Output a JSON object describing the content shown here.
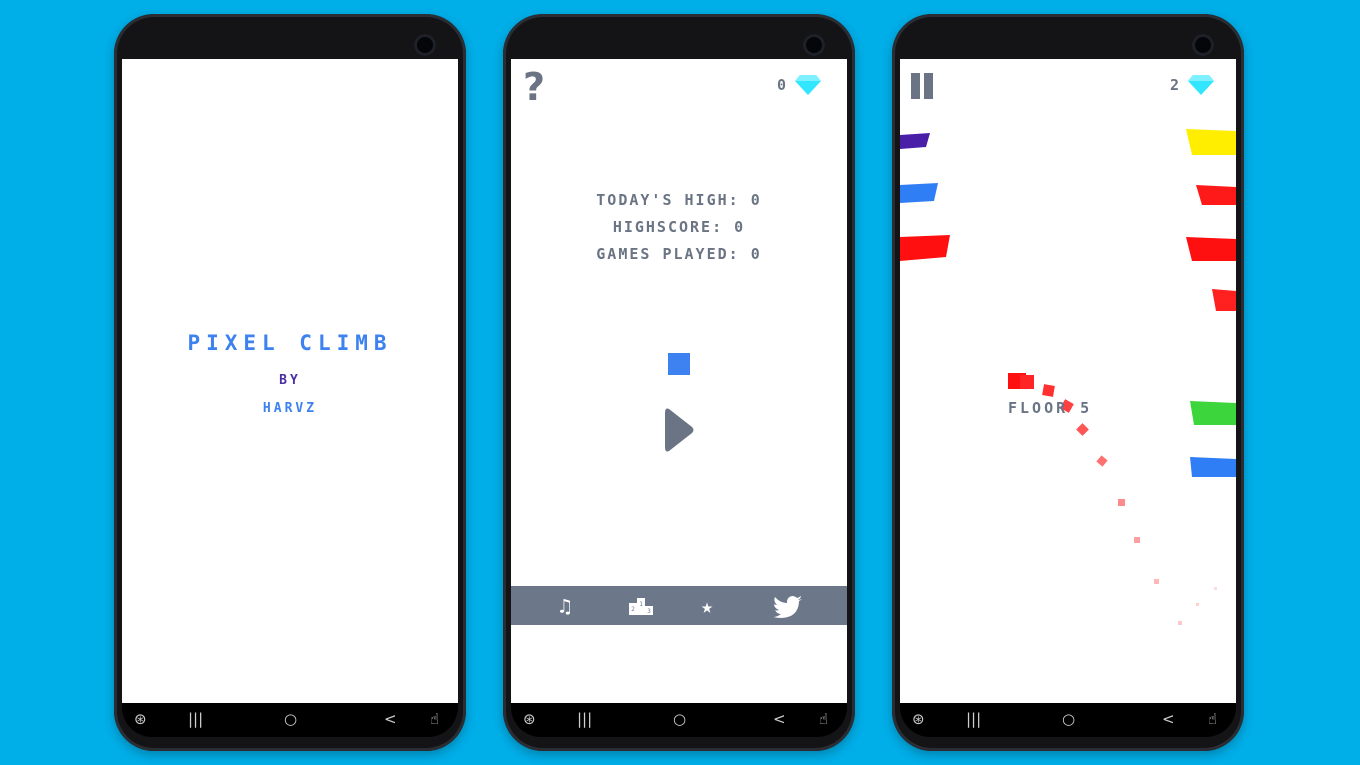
{
  "phone1": {
    "title": "PIXEL CLIMB",
    "by": "BY",
    "author": "HARVZ"
  },
  "phone2": {
    "help_icon": "?",
    "gems": "0",
    "stats": {
      "todays_high": "TODAY'S HIGH: 0",
      "highscore": "HIGHSCORE: 0",
      "games_played": "GAMES PLAYED: 0"
    },
    "menu": [
      "music-icon",
      "leaderboard-icon",
      "star-icon",
      "twitter-icon"
    ]
  },
  "phone3": {
    "gems": "2",
    "floor": "FLOOR 5"
  },
  "colors": {
    "background": "#00aee8",
    "accent_blue": "#3d82f0",
    "gray_text": "#6a7484",
    "gem_cyan": "#33e6ff",
    "menu_bar": "#6c7889"
  },
  "navbar": {
    "recent": "|||",
    "home": "○",
    "back": "<"
  }
}
